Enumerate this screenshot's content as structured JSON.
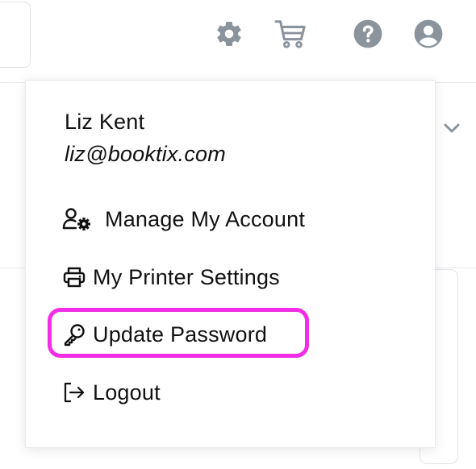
{
  "header": {
    "icons": [
      {
        "name": "gear-icon",
        "color": "#8b939c"
      },
      {
        "name": "cart-icon",
        "color": "#8b939c"
      },
      {
        "name": "help-icon",
        "color": "#8b939c"
      },
      {
        "name": "user-icon",
        "color": "#8b939c"
      }
    ]
  },
  "dropdown": {
    "user_name": "Liz Kent",
    "user_email": "liz@booktix.com",
    "items": [
      {
        "label": "Manage My Account",
        "icon": "user-gear-icon"
      },
      {
        "label": "My Printer Settings",
        "icon": "printer-icon"
      },
      {
        "label": "Update Password",
        "icon": "key-icon",
        "highlighted": true
      },
      {
        "label": "Logout",
        "icon": "logout-icon"
      }
    ]
  },
  "colors": {
    "highlight": "#f22de6",
    "icon_gray": "#8b939c",
    "text": "#111111"
  }
}
